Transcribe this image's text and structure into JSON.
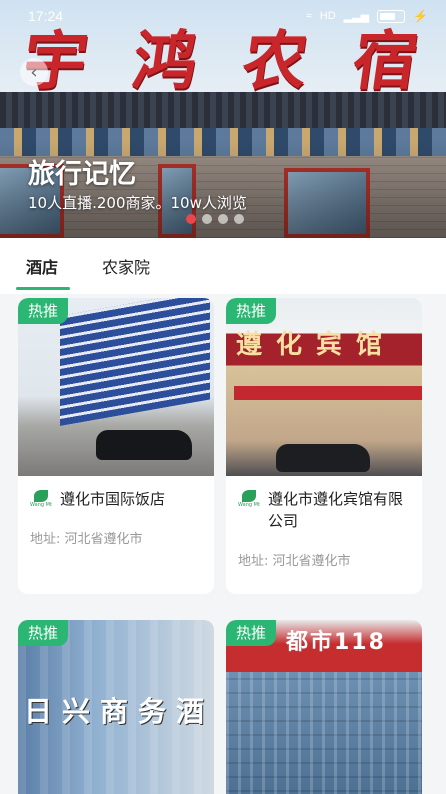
{
  "status_bar": {
    "time": "17:24",
    "signal": "信号",
    "network": "HD",
    "battery": ""
  },
  "hero": {
    "sign_chars": [
      "宇",
      "鸿",
      "农",
      "宿"
    ],
    "title": "旅行记忆",
    "subtitle": "10人直播.200商家。10w人浏览",
    "carousel_total": 4,
    "carousel_active": 1
  },
  "tabs": [
    {
      "label": "酒店",
      "active": true
    },
    {
      "label": "农家院",
      "active": false
    }
  ],
  "cards": [
    {
      "badge": "热推",
      "name": "遵化市国际饭店",
      "address": "地址: 河北省遵化市",
      "photo_text": ""
    },
    {
      "badge": "热推",
      "name": "遵化市遵化宾馆有限公司",
      "address": "地址: 河北省遵化市",
      "photo_text": "遵化宾馆"
    },
    {
      "badge": "热推",
      "name": "",
      "address": "",
      "photo_text": "日兴商务酒"
    },
    {
      "badge": "热推",
      "name": "",
      "address": "",
      "photo_text": "都市118"
    }
  ],
  "logo_mark": "Wang Mt",
  "colors": {
    "accent": "#2bb673",
    "sign_red": "#c8262b",
    "dot_active": "#e5484d"
  }
}
